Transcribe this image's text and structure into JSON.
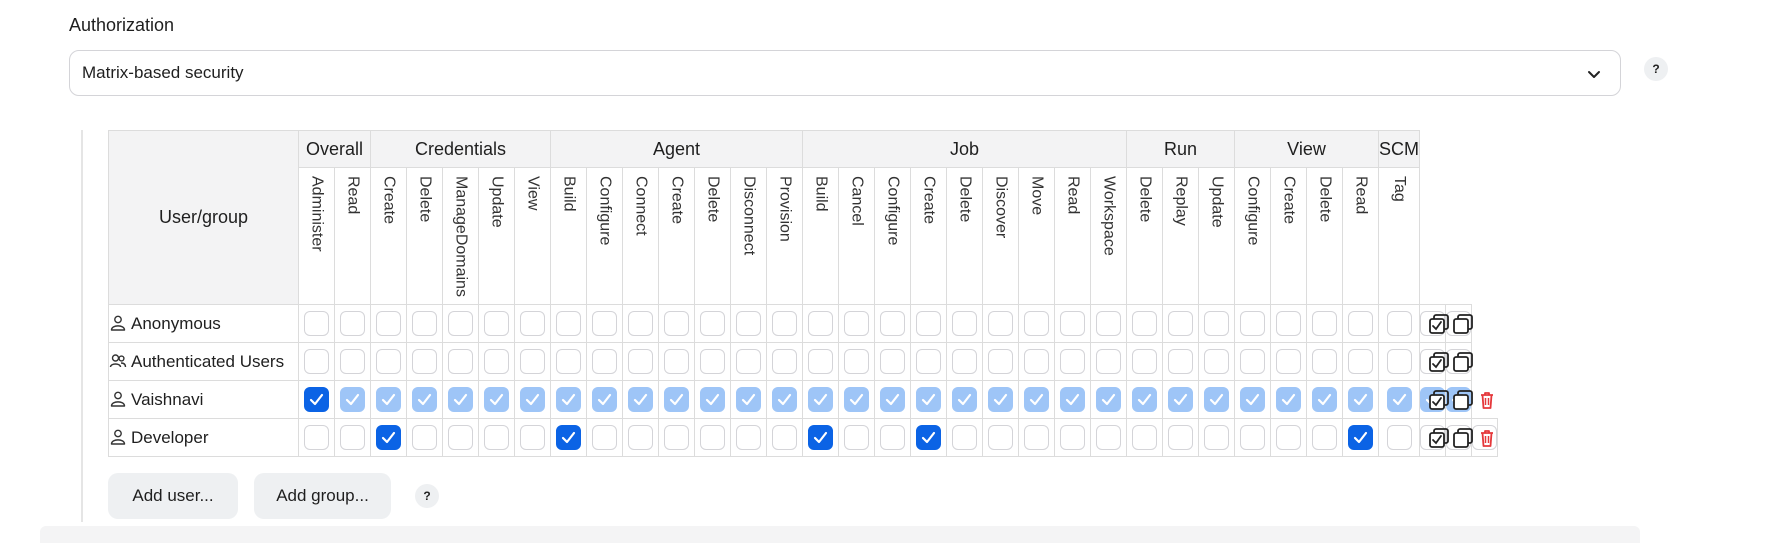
{
  "authorization": {
    "label": "Authorization",
    "strategy": "Matrix-based security",
    "help": "?"
  },
  "matrix": {
    "user_group_header": "User/group",
    "categories": [
      {
        "name": "Overall",
        "perms": [
          "Administer",
          "Read"
        ]
      },
      {
        "name": "Credentials",
        "perms": [
          "Create",
          "Delete",
          "ManageDomains",
          "Update",
          "View"
        ]
      },
      {
        "name": "Agent",
        "perms": [
          "Build",
          "Configure",
          "Connect",
          "Create",
          "Delete",
          "Disconnect",
          "Provision"
        ]
      },
      {
        "name": "Job",
        "perms": [
          "Build",
          "Cancel",
          "Configure",
          "Create",
          "Delete",
          "Discover",
          "Move",
          "Read",
          "Workspace"
        ]
      },
      {
        "name": "Run",
        "perms": [
          "Delete",
          "Replay",
          "Update"
        ]
      },
      {
        "name": "View",
        "perms": [
          "Configure",
          "Create",
          "Delete",
          "Read"
        ]
      },
      {
        "name": "SCM",
        "perms": [
          "Tag"
        ]
      }
    ],
    "rows": [
      {
        "name": "Anonymous",
        "icon": "user-icon",
        "state": "eeeeeeeeeeeeeeeeeeeeeeeeeeeeeeeee",
        "deletable": false
      },
      {
        "name": "Authenticated Users",
        "icon": "group-icon",
        "state": "eeeeeeeeeeeeeeeeeeeeeeeeeeeeeeeee",
        "deletable": false
      },
      {
        "name": "Vaishnavi",
        "icon": "user-icon",
        "state": "ciiiiiiiiiiiiiiiiiiiiiiiiiiiiiiii",
        "deletable": true
      },
      {
        "name": "Developer",
        "icon": "user-icon",
        "state": "eeceeeeceeeeeeceeceeeeeeeeeeeceeee",
        "deletable": true
      }
    ],
    "state_legend": {
      "c": "checked",
      "i": "implied-checked",
      "e": "unchecked"
    }
  },
  "buttons": {
    "add_user": "Add user...",
    "add_group": "Add group...",
    "help": "?"
  },
  "colors": {
    "checked": "#0b63e5",
    "implied": "#9ec5f7",
    "delete": "#e5383b"
  }
}
